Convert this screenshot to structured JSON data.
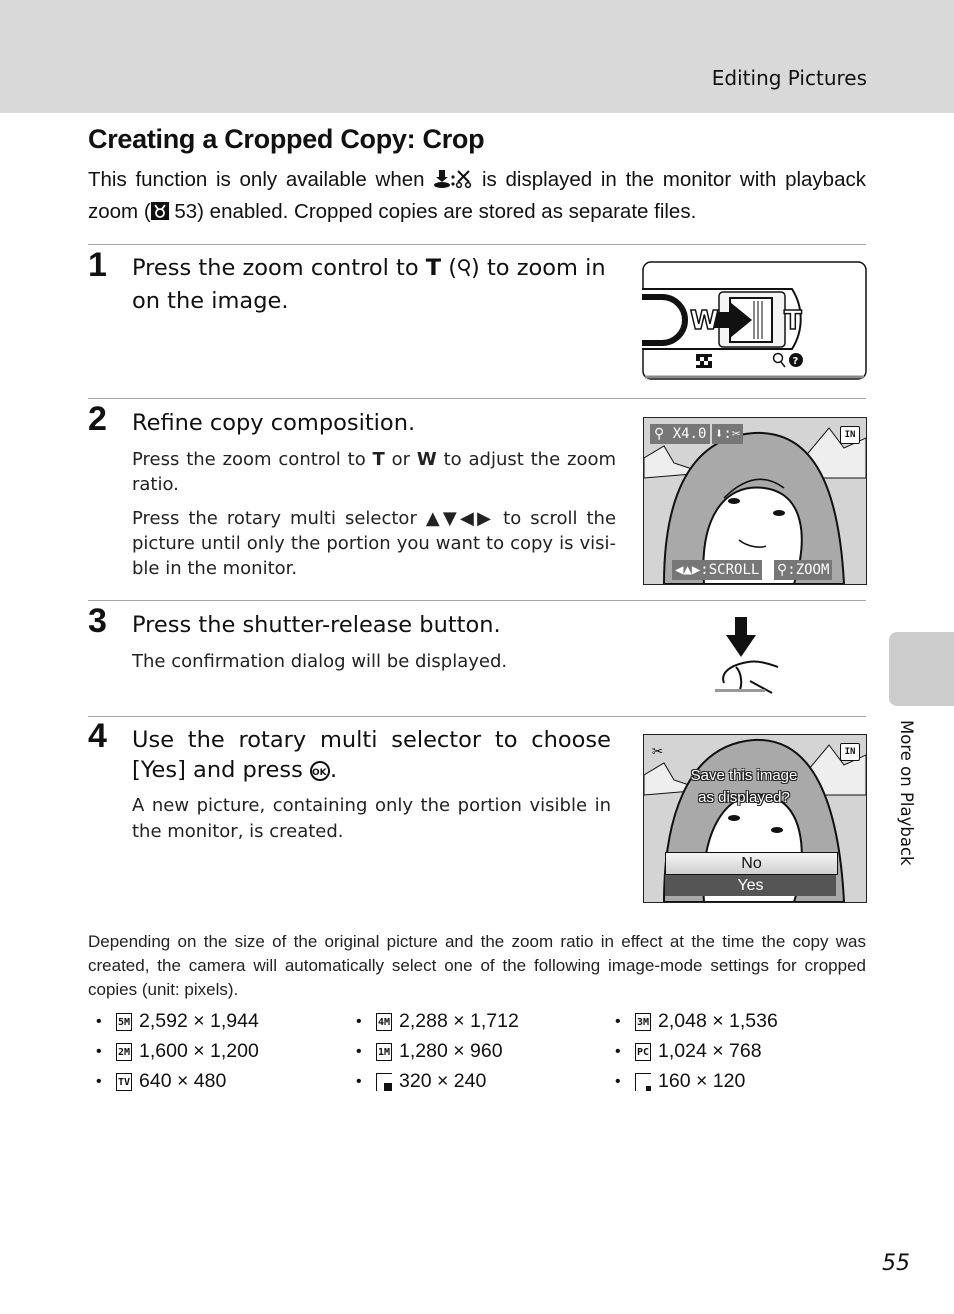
{
  "header": {
    "section_title": "Editing Pictures"
  },
  "page": {
    "title": "Creating a Cropped Copy: Crop",
    "intro_part1": "This function is only available when ",
    "intro_part2": " is displayed in the monitor with playback zoom (",
    "intro_ref": " 53) enabled. Cropped copies are stored as separate files.",
    "page_number": "55",
    "side_tab_label": "More on Playback"
  },
  "steps": [
    {
      "number": "1",
      "heading_part1": "Press the zoom control to ",
      "heading_bold": "T",
      "heading_part2": " (",
      "heading_part3": ") to zoom in on the image.",
      "figure": {
        "label_w": "W",
        "label_t": "T"
      }
    },
    {
      "number": "2",
      "heading": "Refine copy composition.",
      "body1_part1": "Press the zoom control to ",
      "body1_bold_t": "T",
      "body1_mid": " or ",
      "body1_bold_w": "W",
      "body1_part2": " to adjust the zoom ratio.",
      "body2_part1": "Press the rotary multi selector ",
      "body2_arrows": "▲▼◀▶",
      "body2_part2": "  to scroll the picture until only the portion you want to copy is visi-ble in the monitor.",
      "monitor": {
        "zoom_label": "X4.0",
        "memory_label": "IN",
        "scroll_label": ":SCROLL",
        "zoom_hint_label": ":ZOOM"
      }
    },
    {
      "number": "3",
      "heading": "Press the shutter-release button.",
      "body": "The confirmation dialog will be displayed."
    },
    {
      "number": "4",
      "heading_part1": "Use the rotary multi selector to choose [Yes] and press ",
      "heading_ok": "OK",
      "heading_part2": ".",
      "body": "A new picture, containing only the portion visible in the monitor, is created.",
      "monitor": {
        "memory_label": "IN",
        "dialog_line1": "Save this image",
        "dialog_line2": "as displayed?",
        "option_no": "No",
        "option_yes": "Yes",
        "selected_option": "Yes"
      }
    }
  ],
  "note": "Depending on the size of the original picture and the zoom ratio in effect at the time the copy was created, the camera will automatically select one of the following image-mode settings for cropped copies (unit: pixels).",
  "image_modes": [
    {
      "icon": "5M",
      "size": "2,592 × 1,944"
    },
    {
      "icon": "4M",
      "size": "2,288 × 1,712"
    },
    {
      "icon": "3M",
      "size": "2,048 × 1,536"
    },
    {
      "icon": "2M",
      "size": "1,600 × 1,200"
    },
    {
      "icon": "1M",
      "size": "1,280 × 960"
    },
    {
      "icon": "PC",
      "size": "1,024 × 768"
    },
    {
      "icon": "TV",
      "size": "640 × 480"
    },
    {
      "icon": "320",
      "size": "320 × 240"
    },
    {
      "icon": "160",
      "size": "160 × 120"
    }
  ]
}
